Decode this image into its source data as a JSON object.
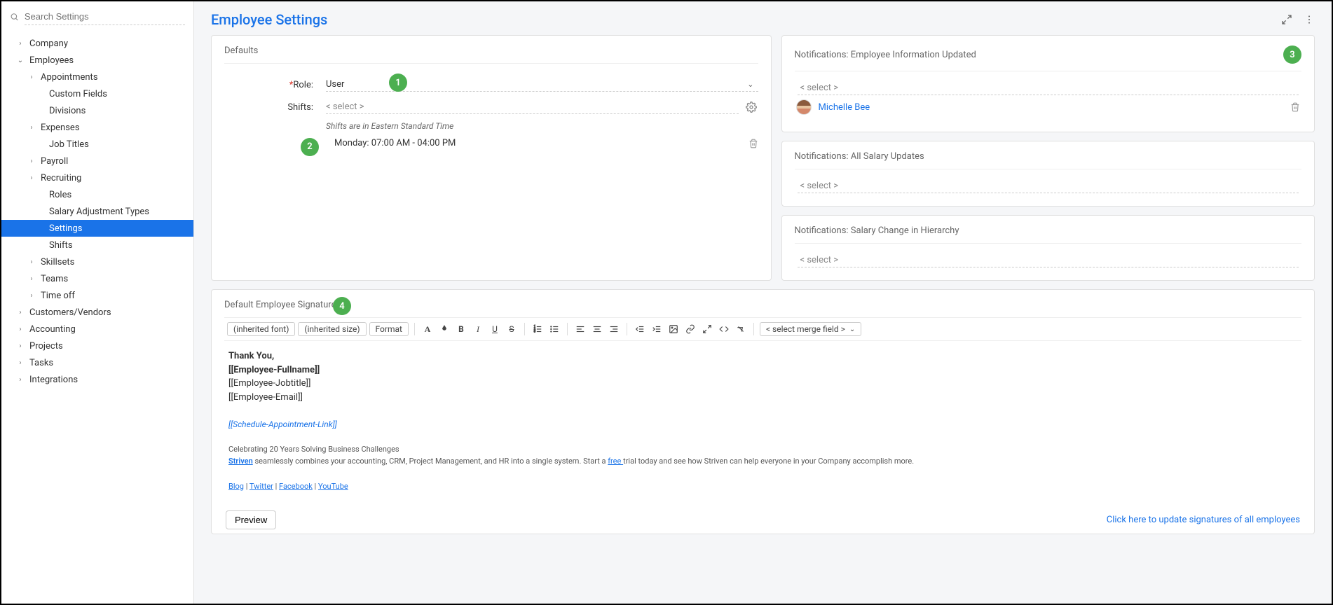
{
  "search": {
    "placeholder": "Search Settings"
  },
  "nav": [
    {
      "label": "Company",
      "level": 0,
      "chev": "right"
    },
    {
      "label": "Employees",
      "level": 0,
      "chev": "down"
    },
    {
      "label": "Appointments",
      "level": 1,
      "chev": "right"
    },
    {
      "label": "Custom Fields",
      "level": 2,
      "chev": ""
    },
    {
      "label": "Divisions",
      "level": 2,
      "chev": ""
    },
    {
      "label": "Expenses",
      "level": 1,
      "chev": "right"
    },
    {
      "label": "Job Titles",
      "level": 2,
      "chev": ""
    },
    {
      "label": "Payroll",
      "level": 1,
      "chev": "right"
    },
    {
      "label": "Recruiting",
      "level": 1,
      "chev": "right"
    },
    {
      "label": "Roles",
      "level": 2,
      "chev": ""
    },
    {
      "label": "Salary Adjustment Types",
      "level": 2,
      "chev": ""
    },
    {
      "label": "Settings",
      "level": 2,
      "chev": "",
      "active": true
    },
    {
      "label": "Shifts",
      "level": 2,
      "chev": ""
    },
    {
      "label": "Skillsets",
      "level": 1,
      "chev": "right"
    },
    {
      "label": "Teams",
      "level": 1,
      "chev": "right"
    },
    {
      "label": "Time off",
      "level": 1,
      "chev": "right"
    },
    {
      "label": "Customers/Vendors",
      "level": 0,
      "chev": "right"
    },
    {
      "label": "Accounting",
      "level": 0,
      "chev": "right"
    },
    {
      "label": "Projects",
      "level": 0,
      "chev": "right"
    },
    {
      "label": "Tasks",
      "level": 0,
      "chev": "right"
    },
    {
      "label": "Integrations",
      "level": 0,
      "chev": "right"
    }
  ],
  "page": {
    "title": "Employee Settings"
  },
  "defaults": {
    "title": "Defaults",
    "role_label": "Role:",
    "role_value": "User",
    "shifts_label": "Shifts:",
    "shifts_placeholder": "< select >",
    "shifts_note": "Shifts are in Eastern Standard Time",
    "shift_item": "Monday: 07:00 AM - 04:00 PM"
  },
  "notifications": {
    "panel1_title": "Notifications: Employee Information Updated",
    "panel2_title": "Notifications: All Salary Updates",
    "panel3_title": "Notifications: Salary Change in Hierarchy",
    "select_placeholder": "< select >",
    "user_name": "Michelle Bee"
  },
  "signature": {
    "title": "Default Employee Signature",
    "font_sel": "(inherited font)",
    "size_sel": "(inherited size)",
    "format_sel": "Format",
    "merge_sel": "< select merge field >",
    "line1": "Thank You,",
    "line2": "[[Employee-Fullname]]",
    "line3": "[[Employee-Jobtitle]]",
    "line4": "[[Employee-Email]]",
    "line5": "[[Schedule-Appointment-Link]]",
    "line6": "Celebrating 20 Years Solving Business Challenges",
    "line7a": "Striven",
    "line7b": " seamlessly combines your accounting, CRM, Project Management, and HR into a single system. Start a ",
    "line7c": "free ",
    "line7d": "trial today and see how Striven can help everyone in your Company accomplish more.",
    "social": {
      "blog": "Blog",
      "twitter": "Twitter",
      "facebook": "Facebook",
      "youtube": "YouTube",
      "sep": " | "
    },
    "preview": "Preview",
    "update_link": "Click here to update signatures of all employees"
  },
  "badges": {
    "b1": "1",
    "b2": "2",
    "b3": "3",
    "b4": "4"
  }
}
